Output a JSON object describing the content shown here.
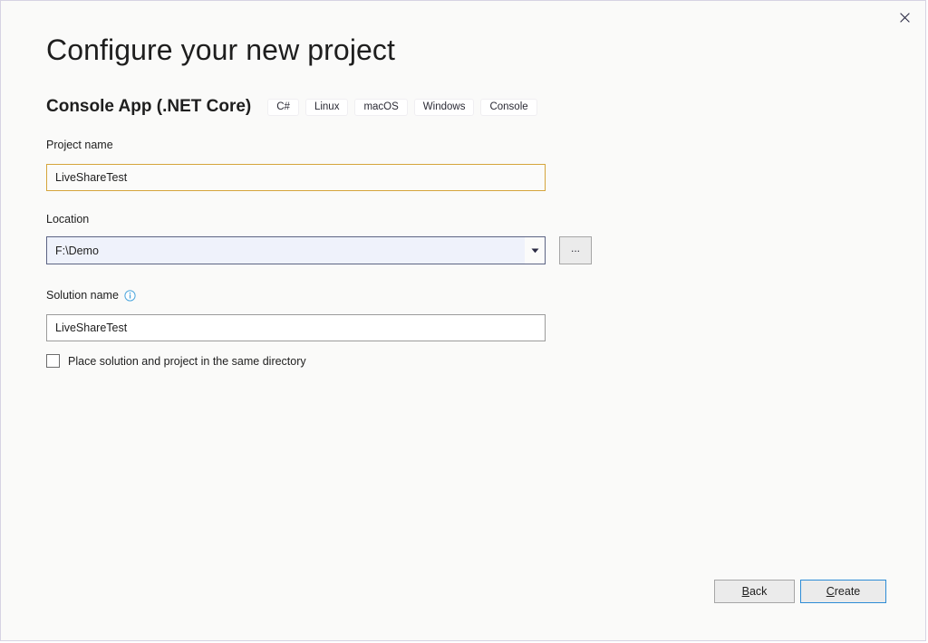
{
  "window": {
    "close_icon": "close-icon"
  },
  "header": {
    "title": "Configure your new project",
    "template_name": "Console App (.NET Core)",
    "tags": [
      "C#",
      "Linux",
      "macOS",
      "Windows",
      "Console"
    ]
  },
  "form": {
    "project_name": {
      "label": "Project name",
      "value": "LiveShareTest",
      "placeholder": ""
    },
    "location": {
      "label": "Location",
      "value": "F:\\Demo",
      "placeholder": "",
      "dropdown_icon": "chevron-down-icon",
      "browse_label": "...",
      "options": [
        "F:\\Demo"
      ]
    },
    "solution_name": {
      "label": "Solution name",
      "info_icon": "info-circle-icon",
      "value": "LiveShareTest",
      "placeholder": ""
    },
    "same_directory_checkbox": {
      "label": "Place solution and project in the same directory",
      "checked": false
    }
  },
  "footer": {
    "back": {
      "accesskey": "B",
      "rest": "ack"
    },
    "create": {
      "accesskey": "C",
      "rest": "reate"
    }
  },
  "colors": {
    "background": "#fafaf9",
    "window_border": "#d6d3e3",
    "focus_border": "#d5a53c",
    "combo_background": "#eff2fb",
    "combo_border": "#5c6484",
    "accent_blue": "#2d8cd6",
    "info_blue": "#4ca6dd",
    "text": "#1e1e1e"
  }
}
